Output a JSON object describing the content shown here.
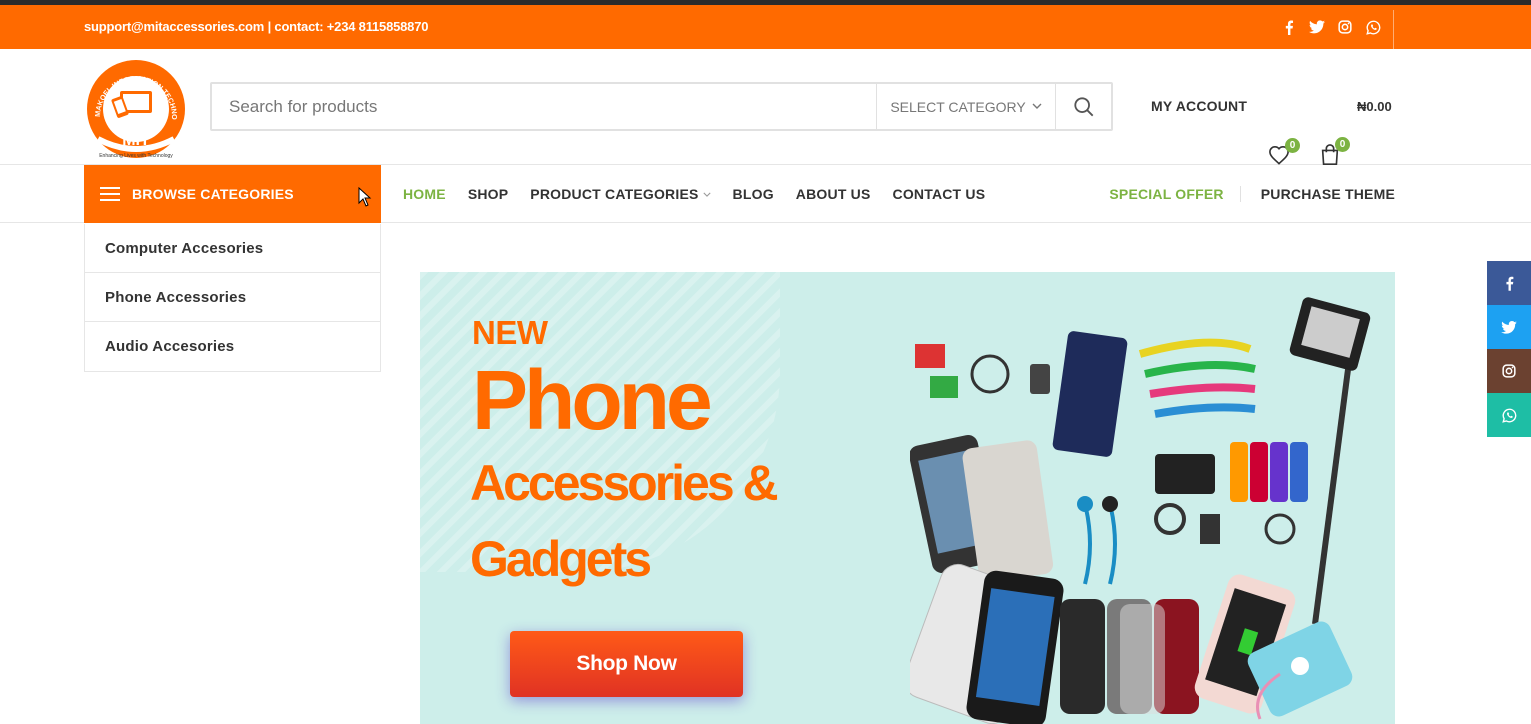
{
  "topbar": {
    "contact": "support@mitaccessories.com | contact: +234 8115858870",
    "socials": [
      "facebook-icon",
      "twitter-icon",
      "instagram-icon",
      "whatsapp-icon"
    ]
  },
  "header": {
    "logo_text": "MIT",
    "logo_ring": "MAKOEL INFORMATION TECHNOLOGY",
    "logo_tagline": "Enhancing Lives with Technology",
    "search_placeholder": "Search for products",
    "select_category": "SELECT CATEGORY",
    "my_account": "MY ACCOUNT",
    "wishlist_count": "0",
    "cart_count": "0",
    "cart_total": "₦0.00"
  },
  "nav": {
    "browse_label": "BROWSE CATEGORIES",
    "items": [
      "HOME",
      "SHOP",
      "PRODUCT CATEGORIES",
      "BLOG",
      "ABOUT US",
      "CONTACT US"
    ],
    "special_offer": "SPECIAL OFFER",
    "purchase_theme": "PURCHASE THEME"
  },
  "categories": [
    "Computer Accesories",
    "Phone Accessories",
    "Audio Accesories"
  ],
  "banner": {
    "new": "NEW",
    "title": "Phone",
    "subtitle1": "Accessories &",
    "subtitle2": "Gadgets",
    "cta": "Shop Now"
  },
  "colors": {
    "brand_orange": "#ff6a00",
    "accent_green": "#7cb342",
    "banner_bg": "#cdeeea"
  },
  "side_social": [
    "facebook-icon",
    "twitter-icon",
    "instagram-icon",
    "whatsapp-icon"
  ]
}
